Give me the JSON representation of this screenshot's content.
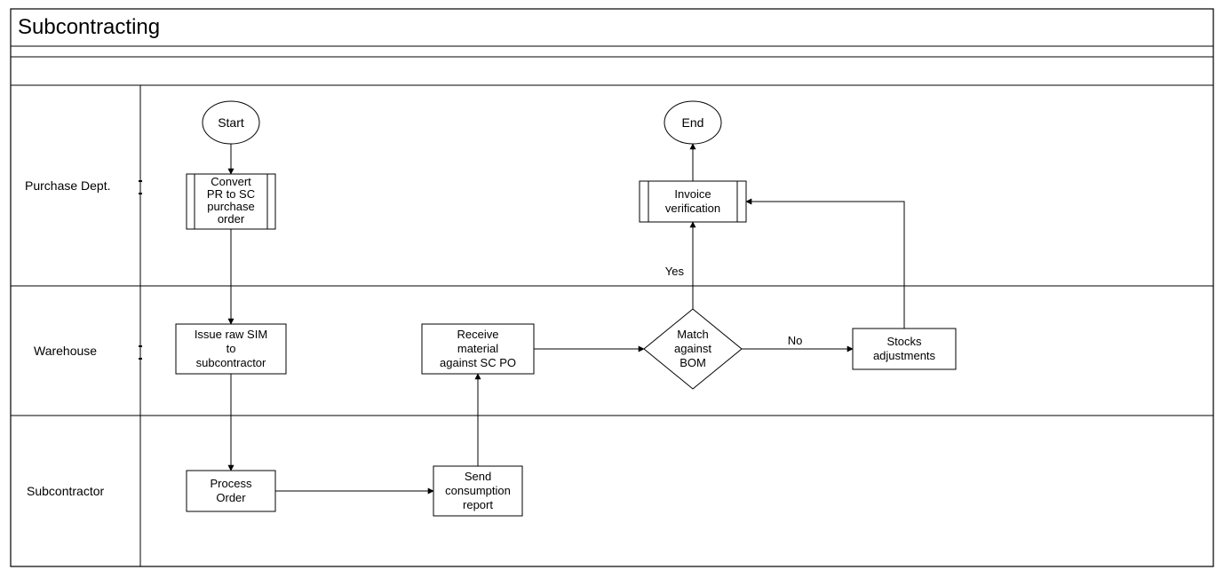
{
  "title": "Subcontracting",
  "lanes": {
    "purchase": "Purchase Dept.",
    "warehouse": "Warehouse",
    "subcontractor": "Subcontractor"
  },
  "terminators": {
    "start": "Start",
    "end": "End"
  },
  "nodes": {
    "convert_pr": {
      "l1": "Convert",
      "l2": "PR to SC",
      "l3": "purchase",
      "l4": "order"
    },
    "issue_raw": {
      "l1": "Issue raw SIM",
      "l2": "to",
      "l3": "subcontractor"
    },
    "process_order": {
      "l1": "Process",
      "l2": "Order"
    },
    "send_report": {
      "l1": "Send",
      "l2": "consumption",
      "l3": "report"
    },
    "receive_material": {
      "l1": "Receive",
      "l2": "material",
      "l3": "against SC PO"
    },
    "match_bom": {
      "l1": "Match",
      "l2": "against",
      "l3": "BOM"
    },
    "stocks_adj": {
      "l1": "Stocks",
      "l2": "adjustments"
    },
    "invoice_ver": {
      "l1": "Invoice",
      "l2": "verification"
    }
  },
  "edge_labels": {
    "yes": "Yes",
    "no": "No"
  }
}
